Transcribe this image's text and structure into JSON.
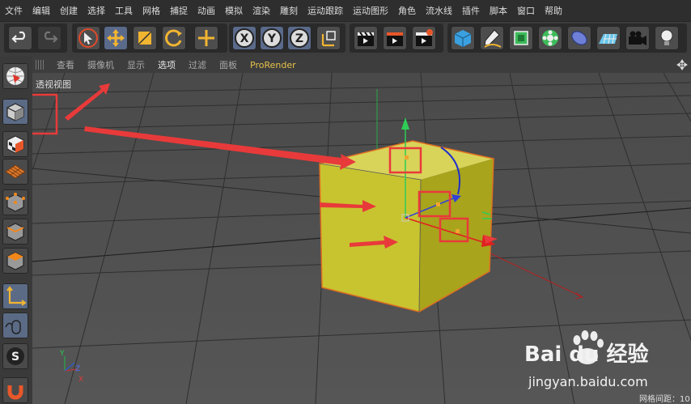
{
  "menu": [
    "文件",
    "编辑",
    "创建",
    "选择",
    "工具",
    "网格",
    "捕捉",
    "动画",
    "模拟",
    "渲染",
    "雕刻",
    "运动跟踪",
    "运动图形",
    "角色",
    "流水线",
    "插件",
    "脚本",
    "窗口",
    "帮助"
  ],
  "viewport": {
    "menu": [
      "查看",
      "摄像机",
      "显示",
      "选项",
      "过滤",
      "面板",
      "ProRender"
    ],
    "active_menu": "选项",
    "label": "透视视图"
  },
  "axes": {
    "x": "X",
    "y": "Y",
    "z": "Z"
  },
  "status": {
    "grid_spacing": "网格间距：10"
  },
  "toolbar": {
    "x_label": "X",
    "y_label": "Y",
    "z_label": "Z"
  },
  "colors": {
    "cube_face": "#c8c430",
    "cube_side": "#a8a41c",
    "annotation": "#e83a3a",
    "selection_outline": "#e07020"
  },
  "watermark": {
    "logo": "Bai du 经验",
    "url": "jingyan.baidu.com"
  }
}
